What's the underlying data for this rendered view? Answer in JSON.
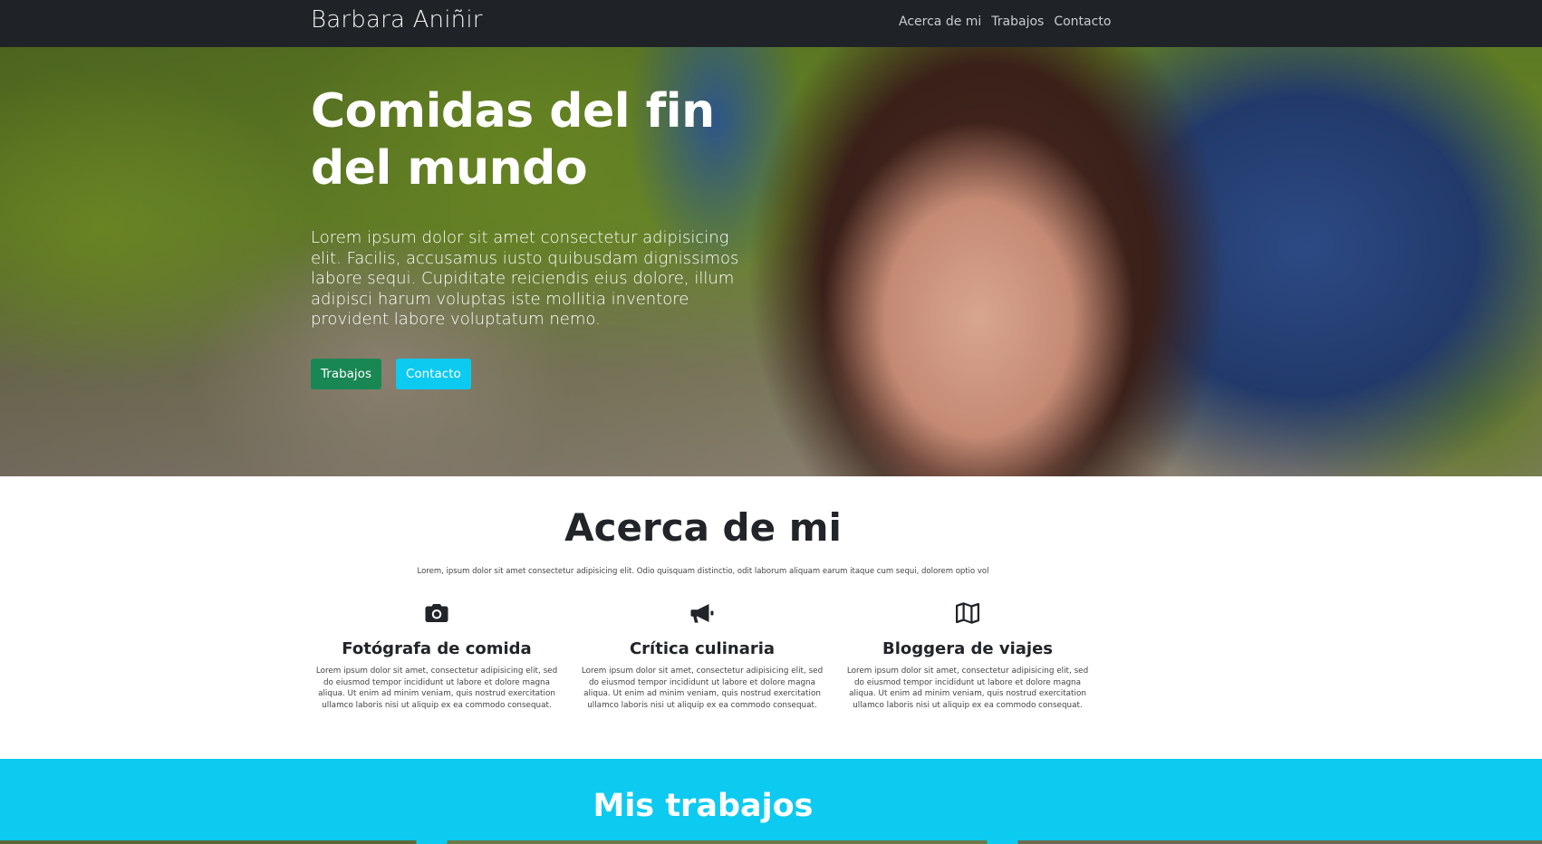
{
  "navbar": {
    "brand": "Barbara Aniñir",
    "links": [
      "Acerca de mi",
      "Trabajos",
      "Contacto"
    ]
  },
  "hero": {
    "title": "Comidas del fin del mundo",
    "text": "Lorem ipsum dolor sit amet consectetur adipisicing elit. Facilis, accusamus iusto quibusdam dignissimos labore sequi. Cupiditate reiciendis eius dolore, illum adipisci harum voluptas iste mollitia inventore provident labore voluptatum nemo.",
    "buttons": [
      "Trabajos",
      "Contacto"
    ],
    "accent_green": "#198754",
    "accent_cyan": "#0dcaf0"
  },
  "about": {
    "title": "Acerca de mi",
    "subtitle": "Lorem, ipsum dolor sit amet consectetur adipisicing elit. Odio quisquam distinctio, odit laborum aliquam earum itaque cum sequi, dolorem optio vol",
    "features": [
      {
        "icon": "camera-icon",
        "title": "Fotógrafa de comida",
        "text": "Lorem ipsum dolor sit amet, consectetur adipisicing elit, sed do eiusmod tempor incididunt ut labore et dolore magna aliqua. Ut enim ad minim veniam, quis nostrud exercitation ullamco laboris nisi ut aliquip ex ea commodo consequat."
      },
      {
        "icon": "megaphone-icon",
        "title": "Crítica culinaria",
        "text": "Lorem ipsum dolor sit amet, consectetur adipisicing elit, sed do eiusmod tempor incididunt ut labore et dolore magna aliqua. Ut enim ad minim veniam, quis nostrud exercitation ullamco laboris nisi ut aliquip ex ea commodo consequat."
      },
      {
        "icon": "map-icon",
        "title": "Bloggera de viajes",
        "text": "Lorem ipsum dolor sit amet, consectetur adipisicing elit, sed do eiusmod tempor incididunt ut labore et dolore magna aliqua. Ut enim ad minim veniam, quis nostrud exercitation ullamco laboris nisi ut aliquip ex ea commodo consequat."
      }
    ]
  },
  "works": {
    "title": "Mis trabajos",
    "background": "#0dcaf0"
  }
}
